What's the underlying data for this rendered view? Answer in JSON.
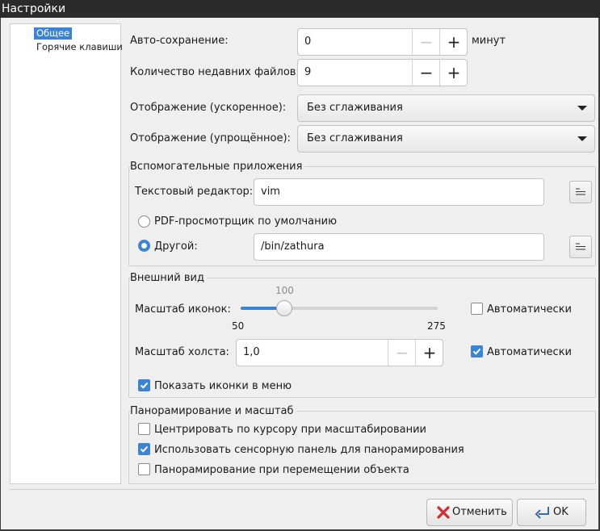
{
  "window": {
    "title": "Настройки"
  },
  "sidebar": {
    "items": [
      {
        "label": "Общее",
        "selected": true
      },
      {
        "label": "Горячие клавиши",
        "selected": false
      }
    ]
  },
  "general": {
    "autosave": {
      "label": "Авто-сохранение:",
      "value": "0",
      "unit": "минут"
    },
    "recent_files": {
      "label": "Количество недавних файлов:",
      "value": "9"
    },
    "render_accel": {
      "label": "Отображение (ускоренное):",
      "value": "Без сглаживания"
    },
    "render_simple": {
      "label": "Отображение (упрощённое):",
      "value": "Без сглаживания"
    }
  },
  "helpers": {
    "title": "Вспомогательные приложения",
    "text_editor": {
      "label": "Текстовый редактор:",
      "value": "vim"
    },
    "pdf_default": {
      "label": "PDF-просмотрщик по умолчанию",
      "selected": false
    },
    "pdf_other": {
      "label": "Другой:",
      "value": "/bin/zathura",
      "selected": true
    }
  },
  "appearance": {
    "title": "Внешний вид",
    "icon_scale": {
      "label": "Масштаб иконок:",
      "value": 100,
      "min": 50,
      "max": 275,
      "value_text": "100",
      "min_text": "50",
      "max_text": "275",
      "auto_label": "Автоматически",
      "auto_checked": false
    },
    "canvas_scale": {
      "label": "Масштаб холста:",
      "value": "1,0",
      "auto_label": "Автоматически",
      "auto_checked": true
    },
    "show_menu_icons": {
      "label": "Показать иконки в меню",
      "checked": true
    }
  },
  "panzoom": {
    "title": "Панорамирование и масштаб",
    "center_cursor": {
      "label": "Центрировать по курсору при масштабировании",
      "checked": false
    },
    "touchpad_pan": {
      "label": "Использовать сенсорную панель для панорамирования",
      "checked": true
    },
    "pan_on_move": {
      "label": "Панорамирование при перемещении объекта",
      "checked": false
    }
  },
  "footer": {
    "cancel_label": "Отменить",
    "ok_label": "OK"
  },
  "icons": {
    "decrement": "−",
    "increment": "+"
  },
  "colors": {
    "accent": "#3a84d8",
    "cancel_icon": "#d42d2d",
    "titlebar": "#2b2b2b"
  }
}
